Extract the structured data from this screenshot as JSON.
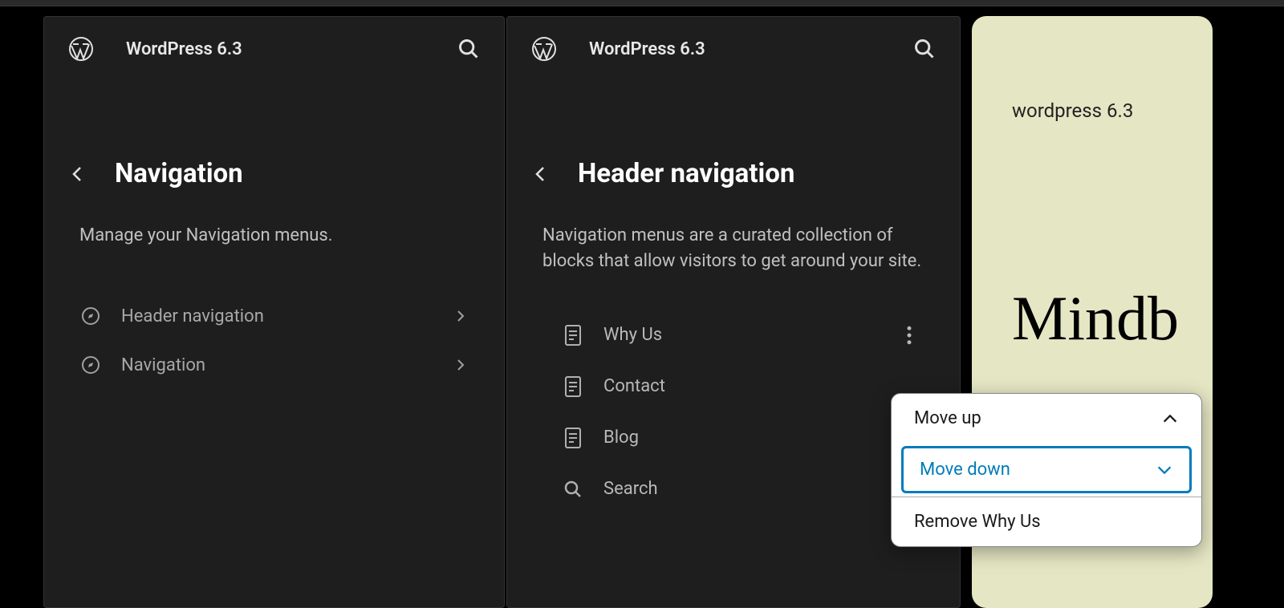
{
  "app_name": "WordPress 6.3",
  "panel_left": {
    "heading": "Navigation",
    "description": "Manage your Navigation menus.",
    "items": [
      {
        "label": "Header navigation"
      },
      {
        "label": "Navigation"
      }
    ]
  },
  "panel_right": {
    "heading": "Header navigation",
    "description": "Navigation menus are a curated collection of blocks that allow visitors to get around your site.",
    "blocks": [
      {
        "label": "Why Us",
        "icon": "page",
        "has_menu": true
      },
      {
        "label": "Contact",
        "icon": "page",
        "has_menu": false
      },
      {
        "label": "Blog",
        "icon": "page",
        "has_menu": false
      },
      {
        "label": "Search",
        "icon": "search",
        "has_menu": false
      }
    ]
  },
  "context_menu": {
    "move_up": "Move up",
    "move_down": "Move down",
    "remove": "Remove Why Us"
  },
  "preview": {
    "brand": "wordpress 6.3",
    "title": "Mindb"
  }
}
